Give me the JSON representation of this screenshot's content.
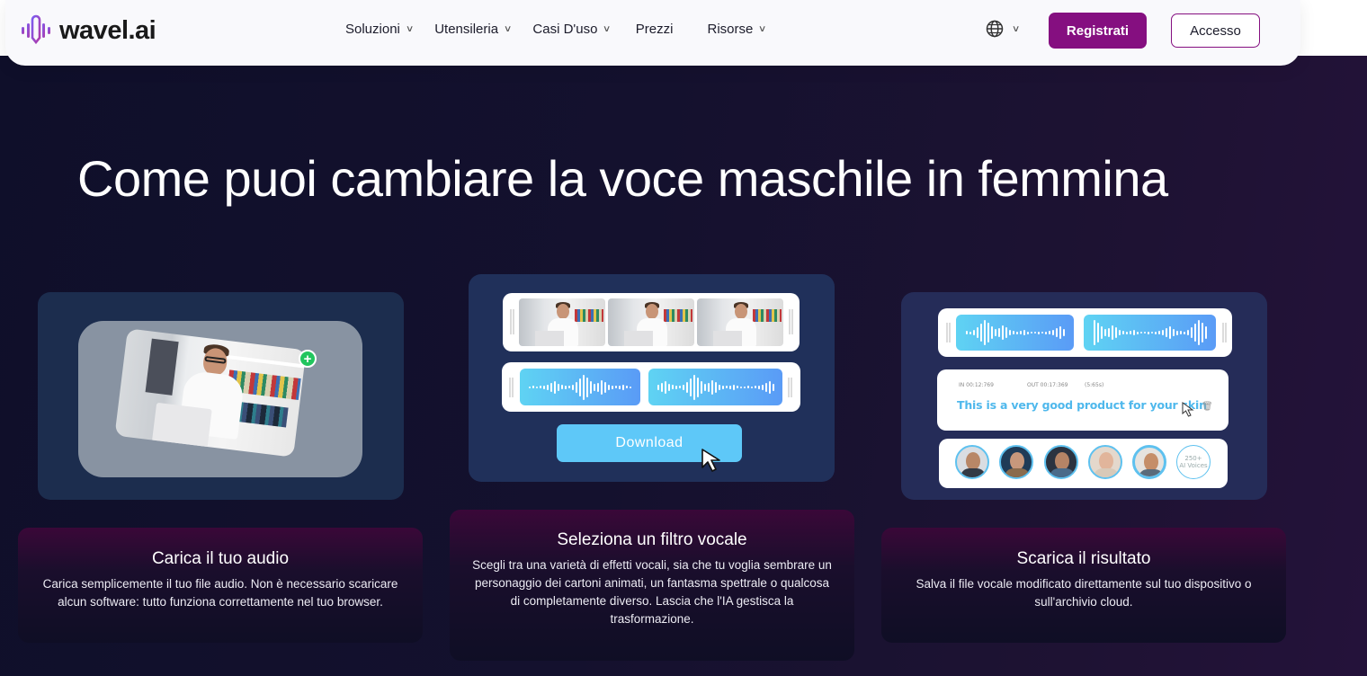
{
  "navbar": {
    "logo_text": "wavel.ai",
    "menu": [
      {
        "label": "Soluzioni",
        "has_dropdown": true
      },
      {
        "label": "Utensileria",
        "has_dropdown": true
      },
      {
        "label": "Casi D'uso",
        "has_dropdown": true
      },
      {
        "label": "Prezzi",
        "has_dropdown": false
      },
      {
        "label": "Risorse",
        "has_dropdown": true
      }
    ],
    "language_icon": "globe-icon",
    "register_label": "Registrati",
    "login_label": "Accesso"
  },
  "colors": {
    "brand": "#850f80",
    "accent_blue": "#5ec8f8",
    "hero_bg": "#14112e"
  },
  "hero": {
    "title": "Come puoi cambiare la voce maschile in femmina"
  },
  "steps": [
    {
      "title": "Carica il tuo audio",
      "description": "Carica semplicemente il tuo file audio. Non è necessario scaricare alcun software: tutto funziona correttamente nel tuo browser."
    },
    {
      "title": "Seleziona un filtro vocale",
      "description": "Scegli tra una varietà di effetti vocali, sia che tu voglia sembrare un personaggio dei cartoni animati, un fantasma spettrale o qualcosa di completamente diverso. Lascia che l'IA gestisca la trasformazione."
    },
    {
      "title": "Scarica il risultato",
      "description": "Salva il file vocale modificato direttamente sul tuo dispositivo o sull'archivio cloud."
    }
  ],
  "illustrations": {
    "download_label": "Download",
    "subtitle_in": "IN 00:12:769",
    "subtitle_out": "OUT 00:17:369",
    "subtitle_duration": "(5:65s)",
    "subtitle_text": "This is a very good product for your skin",
    "voices_count": "250+",
    "voices_label": "AI Voices"
  }
}
